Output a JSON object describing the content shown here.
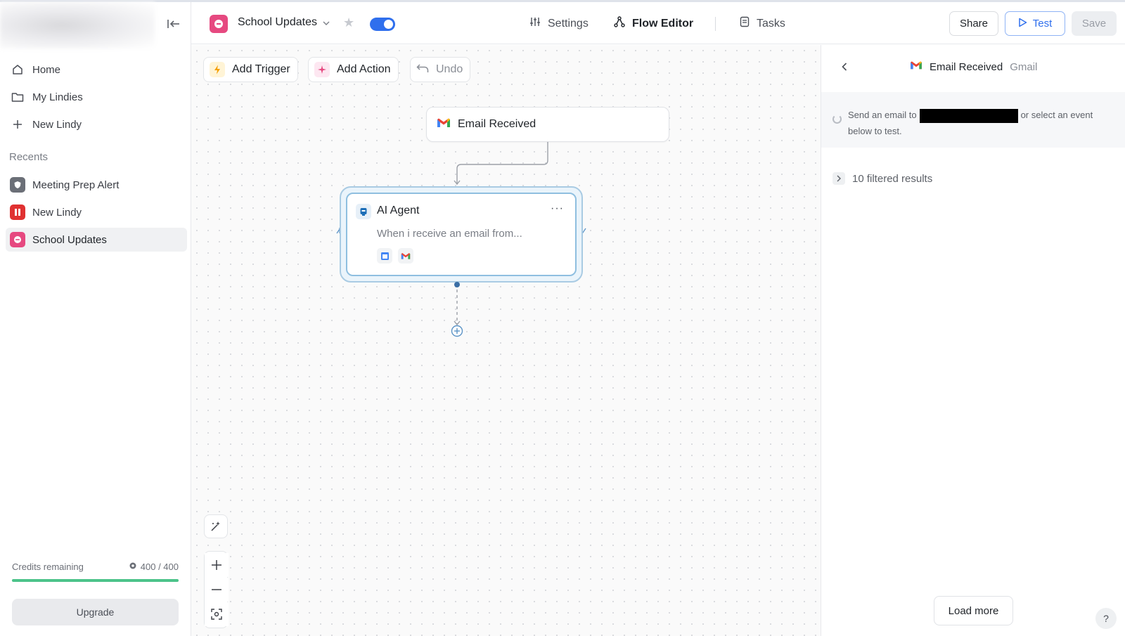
{
  "app": {
    "lindy_name": "School Updates",
    "enabled": true
  },
  "sidebar": {
    "nav": [
      {
        "label": "Home",
        "icon": "home-icon"
      },
      {
        "label": "My Lindies",
        "icon": "folder-icon"
      },
      {
        "label": "New Lindy",
        "icon": "plus-icon"
      }
    ],
    "recents_label": "Recents",
    "recents": [
      {
        "label": "Meeting Prep Alert",
        "color": "#6b6f77"
      },
      {
        "label": "New Lindy",
        "color": "#e03131"
      },
      {
        "label": "School Updates",
        "color": "#e64980"
      }
    ],
    "credits_label": "Credits remaining",
    "credits_value": "400 / 400",
    "credits_fraction": 1.0,
    "upgrade_label": "Upgrade"
  },
  "header": {
    "tabs": [
      {
        "label": "Settings",
        "icon": "sliders-icon"
      },
      {
        "label": "Flow Editor",
        "icon": "flow-icon"
      },
      {
        "label": "Tasks",
        "icon": "tasks-icon"
      }
    ],
    "share_label": "Share",
    "test_label": "Test",
    "save_label": "Save"
  },
  "canvas": {
    "add_trigger_label": "Add Trigger",
    "add_action_label": "Add Action",
    "undo_label": "Undo",
    "trigger_node": {
      "title": "Email Received",
      "icon": "gmail-icon"
    },
    "agent_node": {
      "title": "AI Agent",
      "description": "When i receive an email from...",
      "tools": [
        "calendar-icon",
        "gmail-icon"
      ]
    }
  },
  "panel": {
    "title": "Email Received",
    "subtitle": "Gmail",
    "info_before": "Send an email to",
    "info_after": "or select an event below to test.",
    "filtered_label": "10 filtered results",
    "load_more_label": "Load more",
    "help_label": "?"
  },
  "colors": {
    "accent": "#2f6fed",
    "credits_bar": "#4cc38a",
    "lindy_pink": "#e64980"
  }
}
